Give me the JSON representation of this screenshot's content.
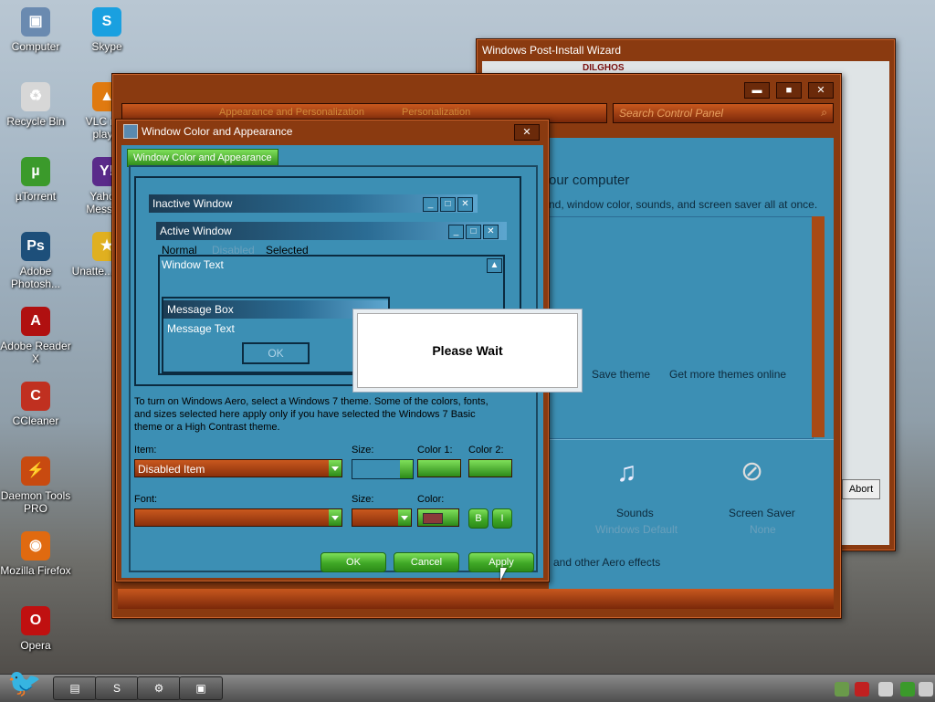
{
  "desktop_icons": [
    {
      "label": "Computer",
      "icon": "computer-icon",
      "color": "#6a8ab0",
      "glyph": "▣"
    },
    {
      "label": "Recycle Bin",
      "icon": "recycle-bin-icon",
      "color": "#d7d7d7",
      "glyph": "♻"
    },
    {
      "label": "µTorrent",
      "icon": "utorrent-icon",
      "color": "#3b9a2b",
      "glyph": "µ"
    },
    {
      "label": "Adobe Photosh...",
      "icon": "photoshop-icon",
      "color": "#1d4f7a",
      "glyph": "Ps"
    },
    {
      "label": "Adobe Reader X",
      "icon": "adobe-reader-icon",
      "color": "#b01010",
      "glyph": "A"
    },
    {
      "label": "CCleaner",
      "icon": "ccleaner-icon",
      "color": "#c03020",
      "glyph": "C"
    },
    {
      "label": "Daemon Tools PRO",
      "icon": "daemon-tools-icon",
      "color": "#c84a10",
      "glyph": "⚡"
    },
    {
      "label": "Mozilla Firefox",
      "icon": "firefox-icon",
      "color": "#e06a10",
      "glyph": "◉"
    },
    {
      "label": "Opera",
      "icon": "opera-icon",
      "color": "#c01010",
      "glyph": "O"
    }
  ],
  "desktop_icons_col2": [
    {
      "label": "Skype",
      "icon": "skype-icon",
      "color": "#1aa0e0",
      "glyph": "S"
    },
    {
      "label": "VLC m... play...",
      "icon": "vlc-icon",
      "color": "#e07a10",
      "glyph": "▲"
    },
    {
      "label": "Yaho... Messe...",
      "icon": "yahoo-messenger-icon",
      "color": "#5a2a8a",
      "glyph": "Y!"
    },
    {
      "label": "Unatte... Sof...",
      "icon": "star-icon",
      "color": "#e0b020",
      "glyph": "★"
    }
  ],
  "wizard": {
    "title": "Windows Post-Install Wizard",
    "logo": "DILGHOS",
    "abort": "Abort"
  },
  "personalization": {
    "breadcrumb_1": "Appearance and Personalization",
    "breadcrumb_2": "Personalization",
    "search_placeholder": "Search Control Panel",
    "heading": "our computer",
    "subheading": "nd, window color, sounds, and screen saver all at once.",
    "save_theme": "Save theme",
    "get_more": "Get more themes online",
    "sounds_label": "Sounds",
    "sounds_sub": "Windows Default",
    "screensaver_label": "Screen Saver",
    "screensaver_sub": "None",
    "aero_text": "and other Aero effects"
  },
  "dialog": {
    "title": "Window Color and Appearance",
    "tab": "Window Color and Appearance",
    "preview": {
      "inactive": "Inactive Window",
      "active": "Active Window",
      "menu_normal": "Normal",
      "menu_disabled": "Disabled",
      "menu_selected": "Selected",
      "window_text": "Window Text",
      "message_box": "Message Box",
      "message_text": "Message Text",
      "ok": "OK"
    },
    "info": "To turn on Windows Aero, select a Windows 7 theme.  Some of the colors, fonts, and sizes selected here apply only if you have selected the Windows 7 Basic theme or a High Contrast theme.",
    "item_label": "Item:",
    "item_value": "Disabled Item",
    "size_label": "Size:",
    "color1_label": "Color 1:",
    "color2_label": "Color 2:",
    "font_label": "Font:",
    "font_size_label": "Size:",
    "color_label": "Color:",
    "bold": "B",
    "italic": "I",
    "ok": "OK",
    "cancel": "Cancel",
    "apply": "Apply"
  },
  "please_wait": "Please Wait",
  "colors": {
    "frame": "#8a3a10",
    "panel": "#3c8fb4",
    "green": "#3fa826"
  }
}
